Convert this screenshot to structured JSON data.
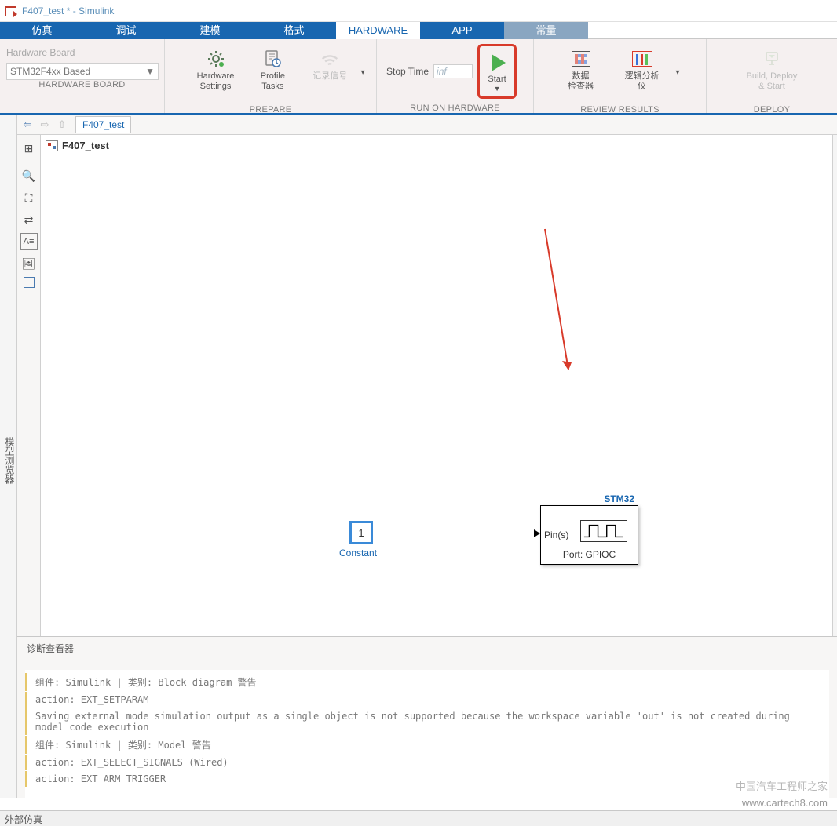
{
  "window": {
    "title": "F407_test * - Simulink"
  },
  "tabs": {
    "sim": "仿真",
    "debug": "调试",
    "model": "建模",
    "format": "格式",
    "hardware": "HARDWARE",
    "app": "APP",
    "const": "常量"
  },
  "ribbon": {
    "hwboard_label": "Hardware Board",
    "hwboard_value": "STM32F4xx Based",
    "hw_settings": "Hardware\nSettings",
    "profile_tasks": "Profile\nTasks",
    "record_signals": "记录信号",
    "stop_time_label": "Stop Time",
    "stop_time_value": "inf",
    "start": "Start",
    "data_inspector": "数据\n检查器",
    "logic_analyzer": "逻辑分析\n仪",
    "build_deploy": "Build, Deploy\n& Start",
    "sections": {
      "hwboard": "HARDWARE BOARD",
      "prepare": "PREPARE",
      "run": "RUN ON HARDWARE",
      "review": "REVIEW RESULTS",
      "deploy": "DEPLOY"
    }
  },
  "leftpanel": "模型浏览器",
  "breadcrumb": "F407_test",
  "model_name": "F407_test",
  "blocks": {
    "constant_value": "1",
    "constant_label": "Constant",
    "stm32_title": "STM32",
    "stm32_pins": "Pin(s)",
    "stm32_port": "Port: GPIOC"
  },
  "diag": {
    "title": "诊断查看器",
    "l1": "组件: Simulink | 类别: Block diagram 警告",
    "l2": "action: EXT_SETPARAM",
    "l3": "Saving external mode simulation output as a single object is not supported because the workspace variable 'out'  is not created during model code execution",
    "l4": "组件: Simulink | 类别: Model 警告",
    "l5": "action: EXT_SELECT_SIGNALS (Wired)",
    "l6": "action: EXT_ARM_TRIGGER"
  },
  "status": "外部仿真",
  "watermark_text": "中国汽车工程师之家",
  "watermark_url": "www.cartech8.com"
}
